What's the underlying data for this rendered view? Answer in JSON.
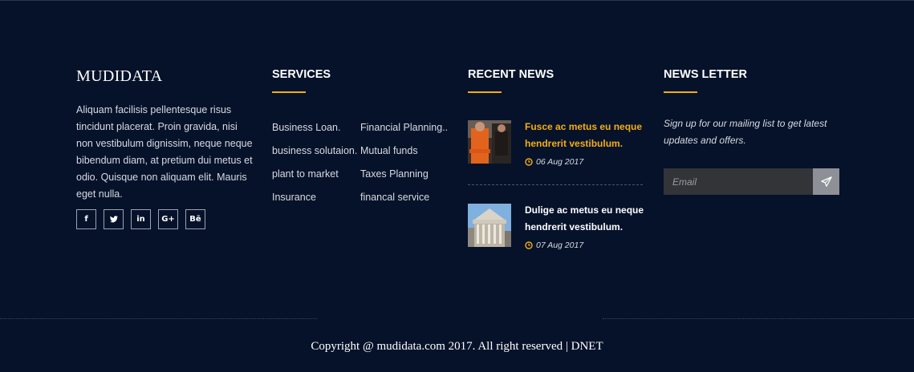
{
  "about": {
    "brand": "MUDIDATA",
    "text": "Aliquam facilisis pellentesque risus tincidunt placerat. Proin gravida, nisi non vestibulum dignissim, neque neque bibendum diam, at pretium dui metus et odio. Quisque non aliquam elit. Mauris eget nulla.",
    "socials": [
      {
        "icon": "facebook-icon",
        "glyph": "f"
      },
      {
        "icon": "twitter-icon",
        "glyph": "t"
      },
      {
        "icon": "linkedin-icon",
        "glyph": "in"
      },
      {
        "icon": "google-plus-icon",
        "glyph": "G+"
      },
      {
        "icon": "behance-icon",
        "glyph": "Bē"
      }
    ]
  },
  "services": {
    "title": "SERVICES",
    "links": [
      "Business Loan.",
      "Financial Planning..",
      "business solutaion.",
      "Mutual funds",
      "plant to market",
      "Taxes Planning",
      "Insurance",
      "financal service"
    ]
  },
  "news": {
    "title": "RECENT NEWS",
    "items": [
      {
        "title": "Fusce ac metus eu neque hendrerit vestibulum.",
        "date": "06 Aug 2017"
      },
      {
        "title": "Dulige ac metus eu neque hendrerit vestibulum.",
        "date": "07 Aug 2017"
      }
    ]
  },
  "newsletter": {
    "title": "NEWS LETTER",
    "text": "Sign up for our mailing list to get latest updates and offers.",
    "placeholder": "Email",
    "submit_icon": "paper-plane-icon"
  },
  "footer": {
    "copyright": "Copyright @ mudidata.com 2017. All right reserved | DNET"
  },
  "colors": {
    "background": "#06122a",
    "accent": "#f3ad19",
    "text": "#d7dbe3"
  }
}
